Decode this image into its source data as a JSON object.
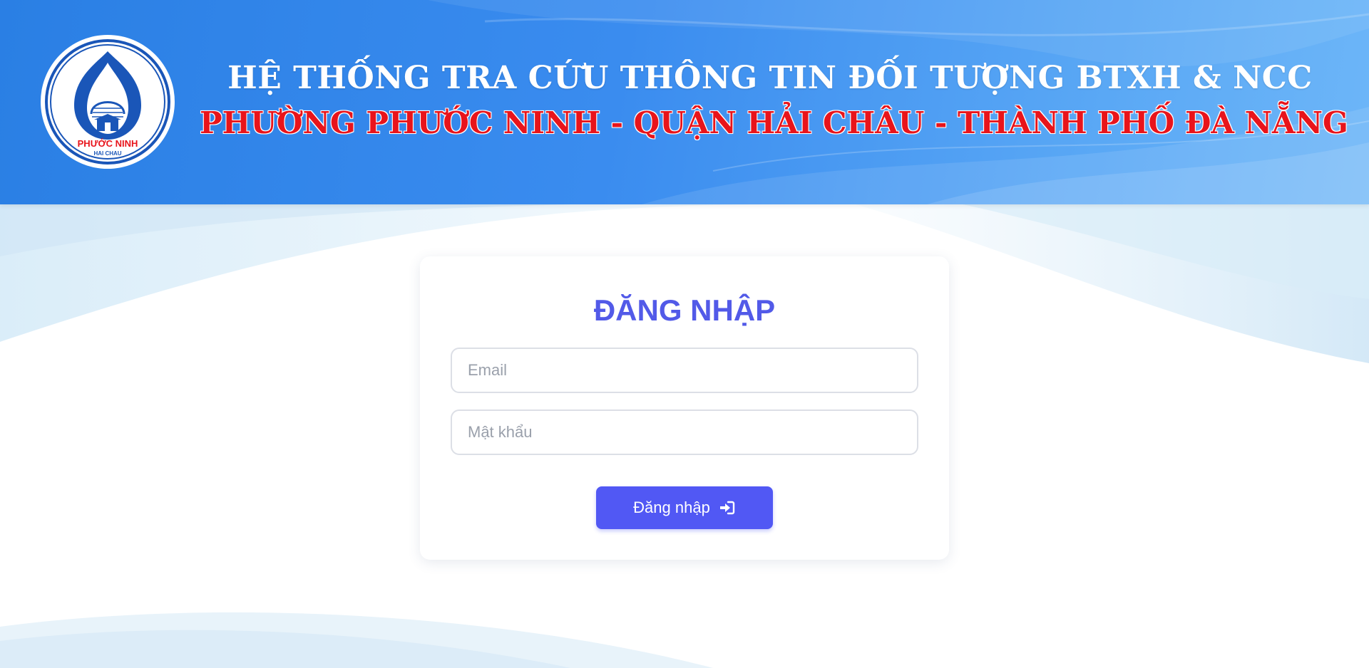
{
  "header": {
    "title": "HỆ THỐNG TRA CỨU THÔNG TIN ĐỐI TƯỢNG BTXH & NCC",
    "subtitle": "PHƯỜNG PHƯỚC NINH - QUẬN HẢI CHÂU - THÀNH PHỐ ĐÀ NẴNG",
    "logo_text_main": "PHƯỚC NINH",
    "logo_text_sub": "HAI CHAU"
  },
  "login": {
    "heading": "ĐĂNG NHẬP",
    "email_placeholder": "Email",
    "password_placeholder": "Mật khẩu",
    "submit_label": "Đăng nhập",
    "submit_icon": "sign-in-icon"
  },
  "colors": {
    "header_blue": "#2a7fe4",
    "subtitle_red": "#e8141b",
    "accent_indigo": "#5158f4",
    "heading_indigo": "#525ae8"
  }
}
